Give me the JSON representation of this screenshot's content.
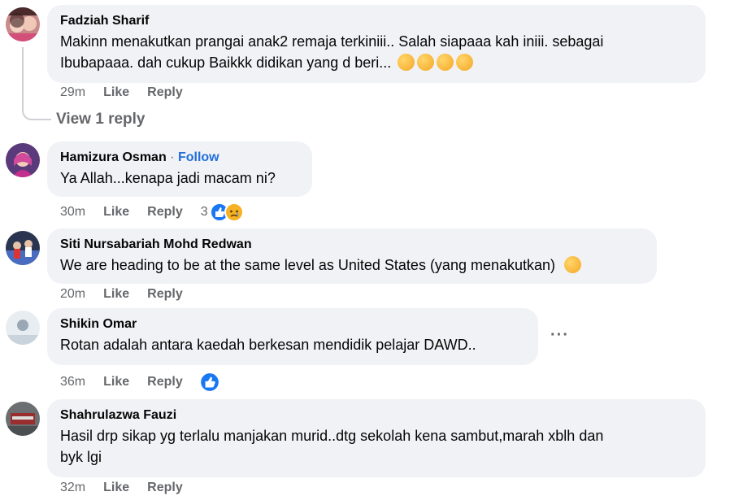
{
  "comments": [
    {
      "author": "Fadziah Sharif",
      "text_line1": "Makinn menakutkan prangai anak2 remaja terkiniii.. Salah siapaaa kah iniii. sebagai",
      "text_line2": "Ibubapaaa. dah cukup Baikkk didikan yang d beri...",
      "time": "29m",
      "like": "Like",
      "reply": "Reply",
      "view_replies": "View 1 reply"
    },
    {
      "author": "Hamizura Osman",
      "follow_sep": "·",
      "follow": "Follow",
      "text": "Ya Allah...kenapa jadi macam ni?",
      "time": "30m",
      "like": "Like",
      "reply": "Reply",
      "reaction_count": "3",
      "reactions": [
        "like-reaction-icon",
        "sad-reaction-icon"
      ]
    },
    {
      "author": "Siti Nursabariah Mohd Redwan",
      "text": "We are heading to be at the same level as United States (yang menakutkan)",
      "time": "20m",
      "like": "Like",
      "reply": "Reply"
    },
    {
      "author": "Shikin Omar",
      "text": "Rotan adalah antara kaedah berkesan mendidik pelajar DAWD..",
      "time": "36m",
      "like": "Like",
      "reply": "Reply",
      "more": "···",
      "reactions": [
        "like-reaction-icon"
      ]
    },
    {
      "author": "Shahrulazwa Fauzi",
      "text_line1": "Hasil drp sikap yg terlalu manjakan murid..dtg sekolah kena sambut,marah xblh dan",
      "text_line2": "byk lgi",
      "time": "32m",
      "like": "Like",
      "reply": "Reply"
    }
  ],
  "colors": {
    "bubble": "#f0f2f5",
    "meta": "#65676b",
    "follow": "#216fdb",
    "like_blue": "#1877f2"
  }
}
